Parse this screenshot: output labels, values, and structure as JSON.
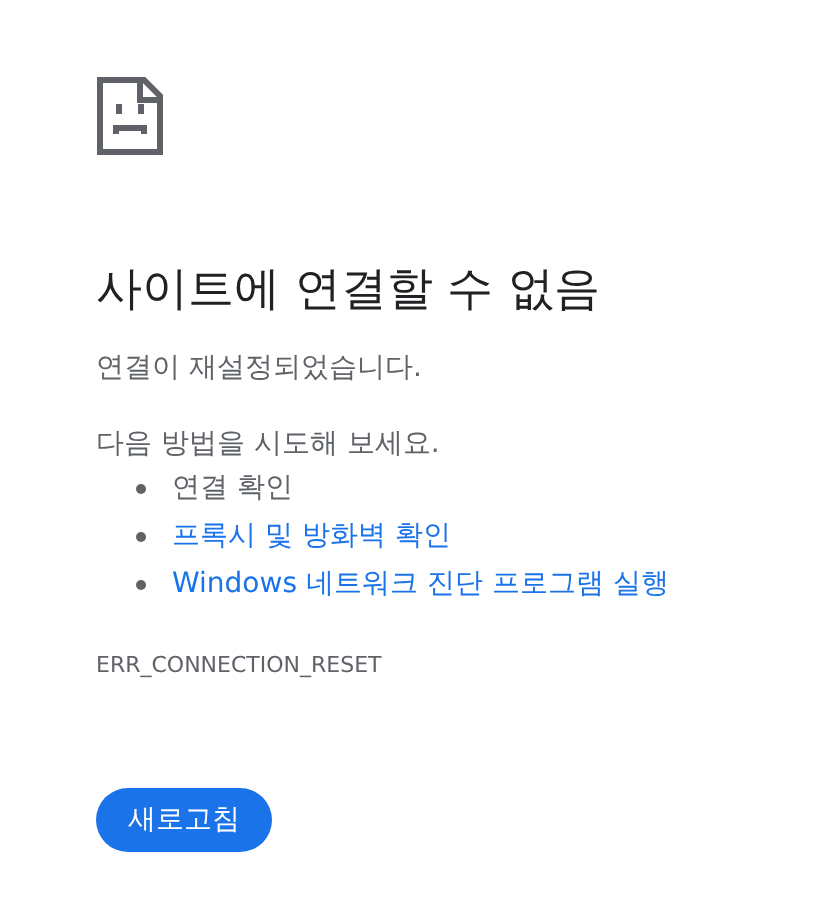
{
  "title": "사이트에 연결할 수 없음",
  "message": "연결이 재설정되었습니다.",
  "suggestions_heading": "다음 방법을 시도해 보세요.",
  "suggestions": [
    {
      "kind": "text",
      "label": "연결 확인"
    },
    {
      "kind": "link",
      "label": "프록시 및 방화벽 확인"
    },
    {
      "kind": "link",
      "label": "Windows 네트워크 진단 프로그램 실행"
    }
  ],
  "error_code": "ERR_CONNECTION_RESET",
  "reload_button": "새로고침"
}
